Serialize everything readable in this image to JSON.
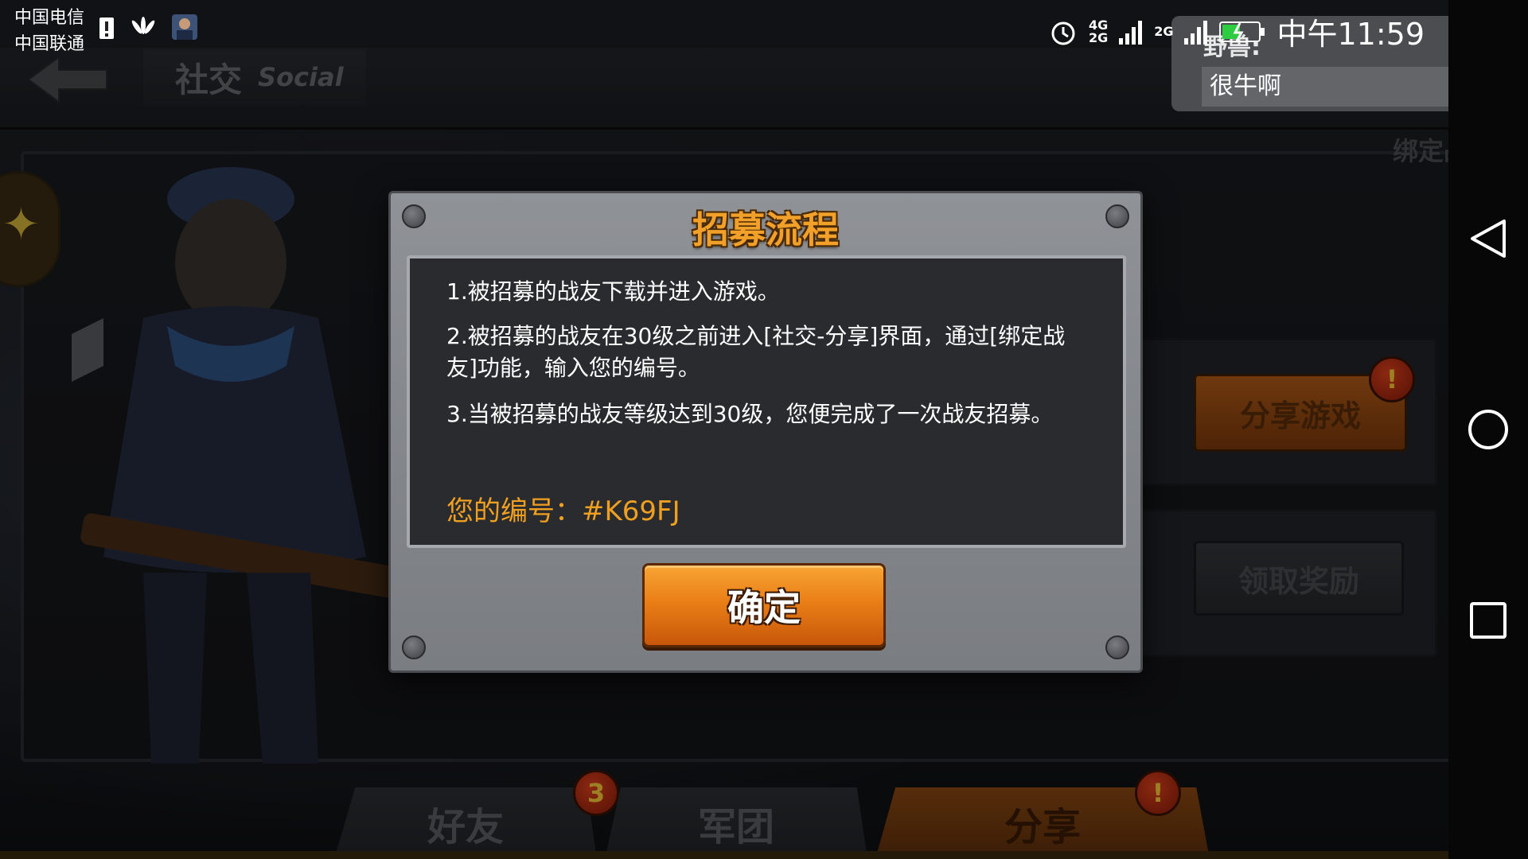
{
  "status_bar": {
    "carrier_1": "中国电信",
    "carrier_2": "中国联通",
    "network_1": "4G",
    "network_2": "2G",
    "network_3": "2G",
    "time": "中午11:59"
  },
  "notification": {
    "sender": "野兽:",
    "message": "很牛啊"
  },
  "header": {
    "title_cn": "社交",
    "title_en": "Social"
  },
  "right_panel": {
    "bind_label": "绑定战友",
    "share_game_label": "分享游戏",
    "share_game_badge": "!",
    "claim_reward_label": "领取奖励"
  },
  "tabs": [
    {
      "label": "好友",
      "badge": "3"
    },
    {
      "label": "军团",
      "badge": ""
    },
    {
      "label": "分享",
      "badge": "!"
    }
  ],
  "modal": {
    "title": "招募流程",
    "steps": [
      "1.被招募的战友下载并进入游戏。",
      "2.被招募的战友在30级之前进入[社交-分享]界面，通过[绑定战友]功能，输入您的编号。",
      "3.当被招募的战友等级达到30级，您便完成了一次战友招募。"
    ],
    "code_label": "您的编号：",
    "code_value": "#K69FJ",
    "confirm_label": "确定"
  },
  "colors": {
    "accent_orange": "#f0a020",
    "modal_bg": "#8a8d92",
    "modal_body": "#2a2b2e",
    "badge_red": "#c0300f"
  },
  "icons": {
    "back": "back-arrow-icon",
    "alarm": "alarm-icon",
    "signal": "signal-icon",
    "battery": "battery-charging-icon",
    "nav_back": "nav-back-icon",
    "nav_home": "nav-home-icon",
    "nav_recent": "nav-recent-icon",
    "more": "more-vertical-icon"
  }
}
